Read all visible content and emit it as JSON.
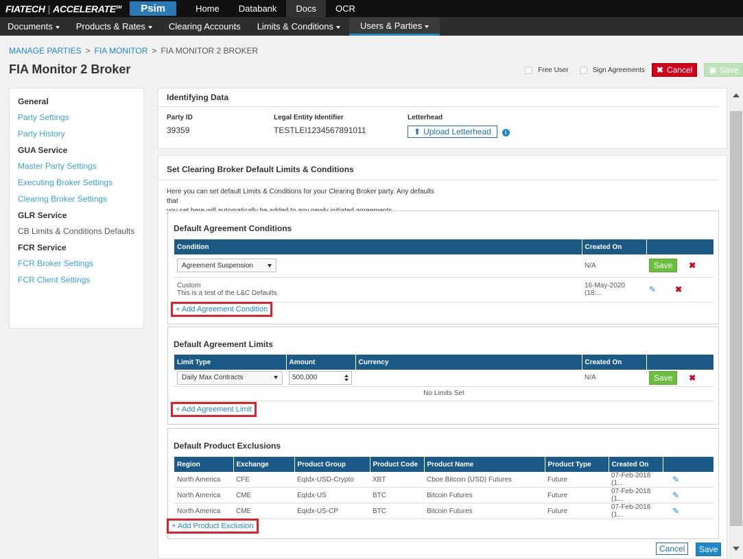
{
  "topbar": {
    "logo_fia": "FIATECH",
    "logo_accel": "ACCELERATE",
    "logo_sm": "SM",
    "app": "Psim",
    "links": [
      "Home",
      "Databank",
      "Docs",
      "OCR"
    ]
  },
  "nav": [
    "Documents",
    "Products & Rates",
    "Clearing Accounts",
    "Limits & Conditions",
    "Users & Parties"
  ],
  "breadcrumb": [
    "MANAGE PARTIES",
    "FIA MONITOR",
    "FIA MONITOR 2 BROKER"
  ],
  "page_title": "FIA Monitor 2 Broker",
  "header_actions": {
    "free_user": "Free User",
    "sign_agreements": "Sign Agreements",
    "cancel": "Cancel",
    "save": "Save"
  },
  "sidebar": {
    "general": "General",
    "party_settings": "Party Settings",
    "party_history": "Party History",
    "gua": "GUA Service",
    "master_party": "Master Party Settings",
    "exec_broker": "Executing Broker Settings",
    "clearing_broker": "Clearing Broker Settings",
    "glr": "GLR Service",
    "cb_limits": "CB Limits & Conditions Defaults",
    "fcr": "FCR Service",
    "fcr_broker": "FCR Broker Settings",
    "fcr_client": "FCR Client Settings"
  },
  "identifying": {
    "title": "Identifying Data",
    "party_id_label": "Party ID",
    "party_id": "39359",
    "lei_label": "Legal Entity Identifier",
    "lei": "TESTLEI1234567891011",
    "letterhead_label": "Letterhead",
    "upload": "Upload Letterhead"
  },
  "defaults": {
    "title": "Set Clearing Broker Default Limits & Conditions",
    "desc1": "Here you can set default Limits & Conditions for your Clearing Broker party. Any defaults that",
    "desc2": "you set here will automatically be added to any newly initiated agreements."
  },
  "conditions": {
    "title": "Default Agreement Conditions",
    "col_condition": "Condition",
    "col_created": "Created On",
    "row1_select": "Agreement Suspension",
    "row1_created": "N/A",
    "row1_save": "Save",
    "row2_type": "Custom",
    "row2_text": "This is a test of the L&C Defaults",
    "row2_created": "16-May-2020 (18:...",
    "add": "+ Add Agreement Condition"
  },
  "limits": {
    "title": "Default Agreement Limits",
    "col_type": "Limit Type",
    "col_amount": "Amount",
    "col_currency": "Currency",
    "col_created": "Created On",
    "row1_select": "Daily Max Contracts",
    "row1_amount": "500,000",
    "row1_created": "N/A",
    "row1_save": "Save",
    "empty": "No Limits Set",
    "add": "+ Add Agreement Limit"
  },
  "exclusions": {
    "title": "Default Product Exclusions",
    "cols": [
      "Region",
      "Exchange",
      "Product Group",
      "Product Code",
      "Product Name",
      "Product Type",
      "Created On"
    ],
    "rows": [
      [
        "North America",
        "CFE",
        "EqIdx-USD-Crypto",
        "XBT",
        "Cboe Bitcoin (USD) Futures",
        "Future",
        "07-Feb-2018 (1..."
      ],
      [
        "North America",
        "CME",
        "EqIdx-US",
        "BTC",
        "Bitcoin Futures",
        "Future",
        "07-Feb-2018 (1..."
      ],
      [
        "North America",
        "CME",
        "EqIdx-US-CP",
        "BTC",
        "Bitcoin Futures",
        "Future",
        "07-Feb-2018 (1..."
      ]
    ],
    "add": "+ Add Product Exclusion"
  },
  "footer": {
    "cancel": "Cancel",
    "save": "Save"
  }
}
